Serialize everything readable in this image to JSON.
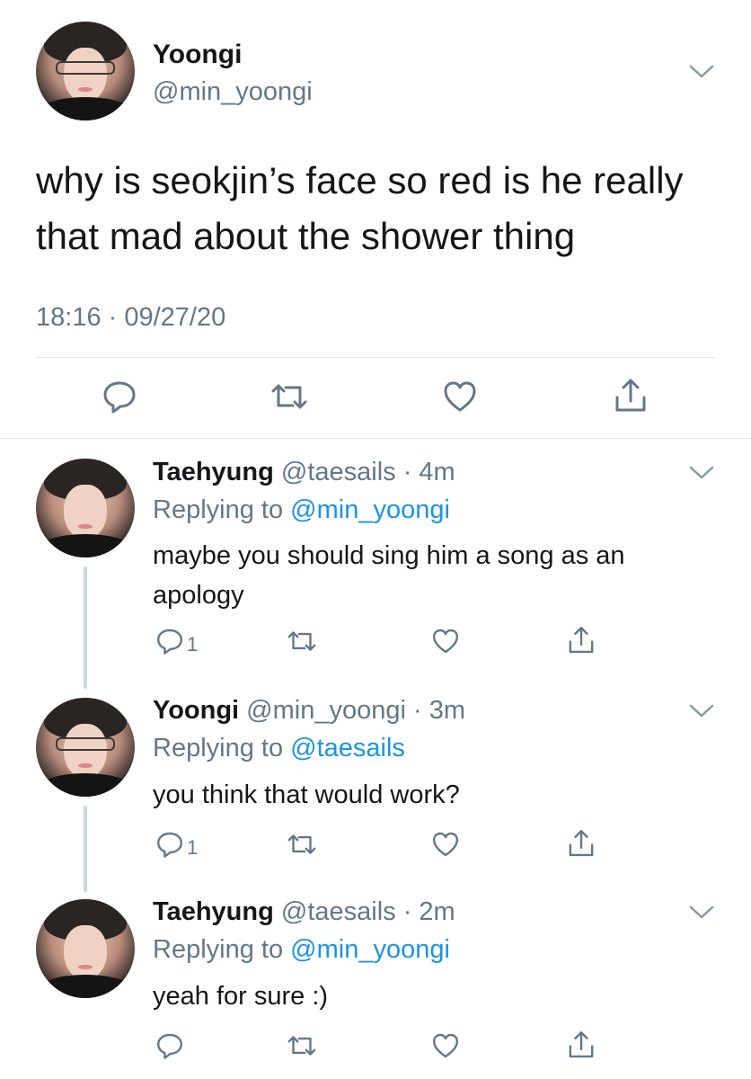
{
  "main_tweet": {
    "display_name": "Yoongi",
    "handle": "@min_yoongi",
    "text": "why is seokjin’s face so red is he really that mad about the shower thing",
    "timestamp": "18:16 · 09/27/20"
  },
  "replies": [
    {
      "display_name": "Taehyung",
      "handle": "@taesails",
      "age": "· 4m",
      "replying_label": "Replying to",
      "replying_to": "@min_yoongi",
      "text": "maybe you should sing him a song as an apology",
      "reply_count": "1"
    },
    {
      "display_name": "Yoongi",
      "handle": "@min_yoongi",
      "age": "· 3m",
      "replying_label": "Replying to",
      "replying_to": "@taesails",
      "text": "you think that would work?",
      "reply_count": "1"
    },
    {
      "display_name": "Taehyung",
      "handle": "@taesails",
      "age": "· 2m",
      "replying_label": "Replying to",
      "replying_to": "@min_yoongi",
      "text": "yeah for sure :)",
      "reply_count": ""
    }
  ],
  "icons": {
    "reply": "reply-icon",
    "retweet": "retweet-icon",
    "like": "like-icon",
    "share": "share-icon",
    "menu": "chevron-down-icon"
  },
  "colors": {
    "link": "#1b95e0",
    "secondary_text": "#657786",
    "icon": "#657786",
    "thread_line": "#ccd6dd"
  }
}
